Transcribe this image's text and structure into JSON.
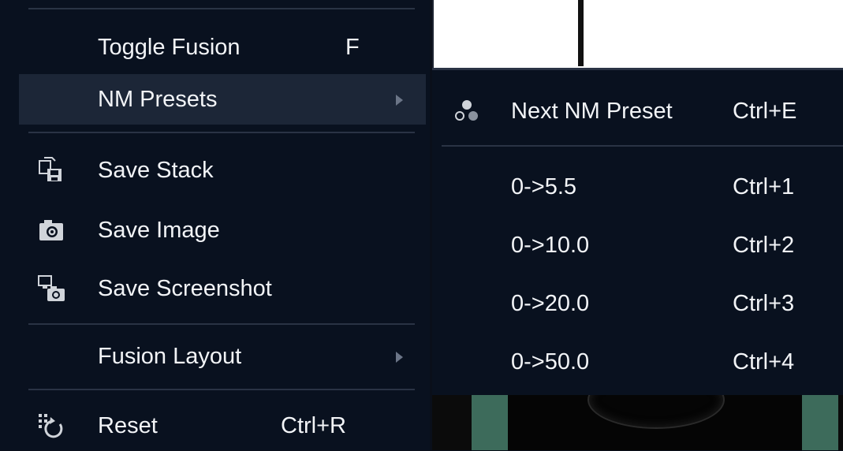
{
  "menu": {
    "items": [
      {
        "label": "Toggle Fusion",
        "shortcut": "F"
      },
      {
        "label": "NM Presets"
      },
      {
        "label": "Save Stack"
      },
      {
        "label": "Save Image"
      },
      {
        "label": "Save Screenshot"
      },
      {
        "label": "Fusion Layout"
      },
      {
        "label": "Reset",
        "shortcut": "Ctrl+R"
      }
    ]
  },
  "submenu": {
    "items": [
      {
        "label": "Next NM Preset",
        "shortcut": "Ctrl+E"
      },
      {
        "label": "0->5.5",
        "shortcut": "Ctrl+1"
      },
      {
        "label": "0->10.0",
        "shortcut": "Ctrl+2"
      },
      {
        "label": "0->20.0",
        "shortcut": "Ctrl+3"
      },
      {
        "label": "0->50.0",
        "shortcut": "Ctrl+4"
      }
    ]
  },
  "icons": {
    "save_stack": "save-stack-icon",
    "save_image": "camera-icon",
    "save_screenshot": "screenshot-icon",
    "reset": "reset-icon",
    "next_preset": "preset-icon"
  },
  "colors": {
    "menu_bg": "#09111f",
    "active_bg": "#1c2637",
    "separator": "#2a3344",
    "text": "#f2f4f7"
  }
}
